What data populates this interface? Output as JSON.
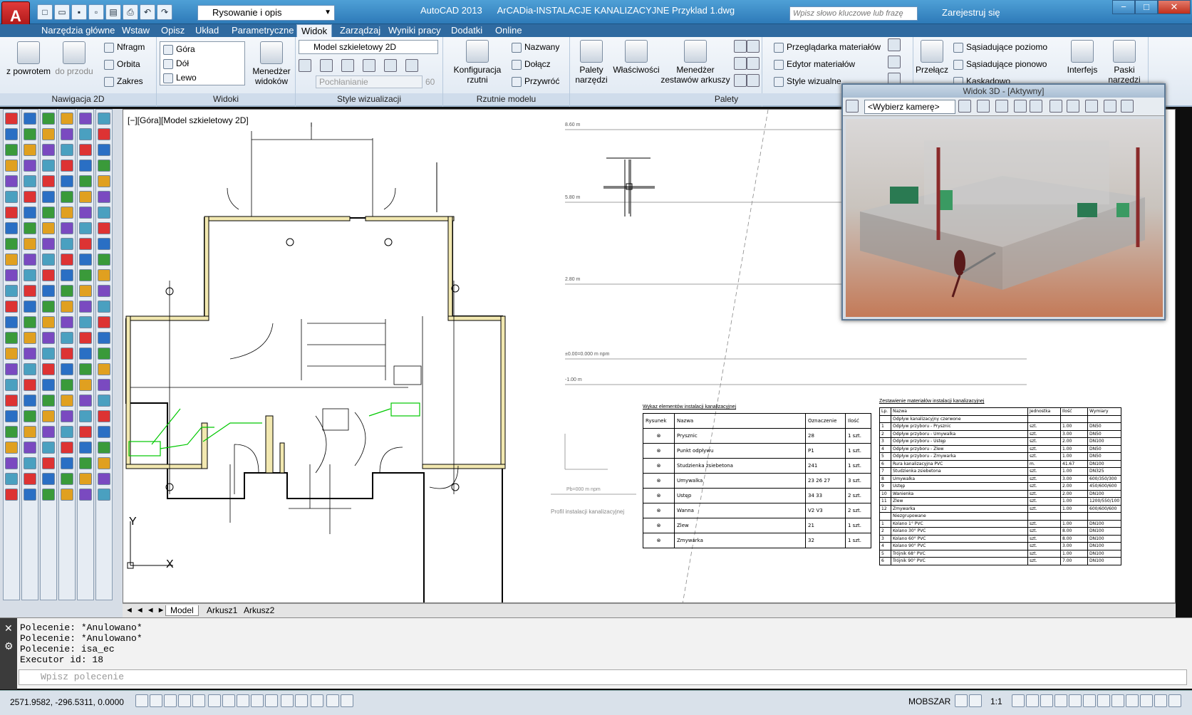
{
  "app": {
    "menu_letter": "A",
    "workspace": "Rysowanie i opis",
    "product": "AutoCAD 2013",
    "document": "ArCADia-INSTALACJE KANALIZACYJNE Przyklad 1.dwg",
    "search_placeholder": "Wpisz słowo kluczowe lub frazę",
    "login": "Zarejestruj się"
  },
  "tabs": [
    "Narzędzia główne",
    "Wstaw",
    "Opisz",
    "Układ",
    "Parametryczne",
    "Widok",
    "Zarządzaj",
    "Wyniki pracy",
    "Dodatki",
    "Online"
  ],
  "active_tab": "Widok",
  "ribbon": {
    "nav_back": "z powrotem",
    "nav_forward": "do przodu",
    "nav_pan": "Nfragm",
    "nav_orbit": "Orbita",
    "nav_range": "Zakres",
    "nav_group": "Nawigacja 2D",
    "views": [
      "Góra",
      "Dół",
      "Lewo"
    ],
    "view_manager_1": "Menedżer",
    "view_manager_2": "widoków",
    "views_group": "Widoki",
    "visual_style": "Model szkieletowy 2D",
    "absorb": "Pochłanianie",
    "absorb_value": "60",
    "visual_group": "Style wizualizacji",
    "config_1": "Konfiguracja",
    "config_2": "rzutni",
    "named": "Nazwany",
    "join": "Dołącz",
    "restore": "Przywróć",
    "viewports_group": "Rzutnie modelu",
    "tool_palettes_1": "Palety",
    "tool_palettes_2": "narzędzi",
    "properties": "Właściwości",
    "sheetset_1": "Menedżer",
    "sheetset_2": "zestawów arkuszy",
    "materials_browser": "Przeglądarka materiałów",
    "materials_editor": "Edytor materiałów",
    "visual_styles": "Style wizualne",
    "palettes_group": "Palety",
    "switch": "Przełącz",
    "tile_h": "Sąsiadujące poziomo",
    "tile_v": "Sąsiadujące pionowo",
    "cascade": "Kaskadowo",
    "interface": "Interfejs",
    "toolbars": "Paski narzędzi"
  },
  "viewport": {
    "label": "[−][Góra][Model szkieletowy 2D]",
    "axis_x": "X",
    "axis_y": "Y"
  },
  "view3d": {
    "title": "Widok 3D - [Aktywny]",
    "camera": "<Wybierz kamerę>"
  },
  "drawing": {
    "levels": [
      "8.60 m",
      "5.80 m",
      "2.80 m",
      "±0.00=0.000 m npm",
      "-1.00 m"
    ],
    "legend_title": "Wykaz elementów instalacji kanalizacyjnej",
    "legend_headers": [
      "Rysunek",
      "Nazwa",
      "Oznaczenie",
      "Ilość"
    ],
    "legend_rows": [
      [
        "Prysznic",
        "28",
        "1 szt."
      ],
      [
        "Punkt odpływu",
        "P1",
        "1 szt."
      ],
      [
        "Studzienka zsiebetona",
        "241",
        "1 szt."
      ],
      [
        "Umywalka",
        "23 26 27",
        "3 szt."
      ],
      [
        "Ustęp",
        "34 33",
        "2 szt."
      ],
      [
        "Wanna",
        "V2 V3",
        "2 szt."
      ],
      [
        "Zlew",
        "21",
        "1 szt."
      ],
      [
        "Zmywarka",
        "32",
        "1 szt."
      ]
    ],
    "materials_title": "Zestawienie materiałów instalacji kanalizacyjnej",
    "materials_headers": [
      "Lp.",
      "Nazwa",
      "Jednostka",
      "Ilość",
      "Wymiary"
    ],
    "materials_rows": [
      [
        "",
        "Odpływ kanalizacyjny czerwone",
        "",
        "",
        ""
      ],
      [
        "1",
        "Odpływ przyboru - Prysznic",
        "szt.",
        "1.00",
        "DN50"
      ],
      [
        "2",
        "Odpływ przyboru - Umywalka",
        "szt.",
        "3.00",
        "DN50"
      ],
      [
        "3",
        "Odpływ przyboru - Ustęp",
        "szt.",
        "2.00",
        "DN100"
      ],
      [
        "4",
        "Odpływ przyboru - Zlew",
        "szt.",
        "1.00",
        "DN50"
      ],
      [
        "5",
        "Odpływ przyboru - Zmywarka",
        "szt.",
        "1.00",
        "DN50"
      ],
      [
        "6",
        "Rura kanalizacyjna PVC",
        "m.",
        "41.67",
        "DN100"
      ],
      [
        "7",
        "Studzienka zsiebetona",
        "szt.",
        "1.00",
        "DN325"
      ],
      [
        "8",
        "Umywalka",
        "szt.",
        "3.00",
        "600/350/300"
      ],
      [
        "9",
        "Ustęp",
        "szt.",
        "2.00",
        "450/600/600"
      ],
      [
        "10",
        "Wanienka",
        "szt.",
        "2.00",
        "DN100"
      ],
      [
        "11",
        "Zlew",
        "szt.",
        "1.00",
        "1200/550/100"
      ],
      [
        "12",
        "Zmywarka",
        "szt.",
        "1.00",
        "600/600/600"
      ],
      [
        "",
        "Niezgrupowane",
        "",
        "",
        ""
      ],
      [
        "1",
        "Kolano 1° PVC",
        "szt.",
        "1.00",
        "DN100"
      ],
      [
        "2",
        "Kolano 30° PVC",
        "szt.",
        "8.00",
        "DN100"
      ],
      [
        "3",
        "Kolano 60° PVC",
        "szt.",
        "8.00",
        "DN100"
      ],
      [
        "4",
        "Kolano 90° PVC",
        "szt.",
        "3.00",
        "DN100"
      ],
      [
        "5",
        "Trójnik 68° PVC",
        "szt.",
        "1.00",
        "DN100"
      ],
      [
        "6",
        "Trójnik 90° PVC",
        "szt.",
        "7.00",
        "DN100"
      ]
    ],
    "profile_label": "Profil instalacji kanalizacyjnej",
    "profile_level": "Pb=000 m npm"
  },
  "sheets": {
    "model": "Model",
    "layout1": "Arkusz1",
    "layout2": "Arkusz2"
  },
  "command": {
    "lines": [
      "Polecenie: *Anulowano*",
      "Polecenie: *Anulowano*",
      "Polecenie: isa_ec",
      "Executor id: 18"
    ],
    "placeholder": "Wpisz polecenie"
  },
  "status": {
    "coords": "2571.9582, -296.5311, 0.0000",
    "mode": "MOBSZAR",
    "scale": "1:1"
  },
  "colors": {
    "green_pipe": "#00c800",
    "wall_hatch": "#f2e8b0",
    "ribbon_bg": "#dfe8f2",
    "title_bg": "#3a88c4"
  }
}
